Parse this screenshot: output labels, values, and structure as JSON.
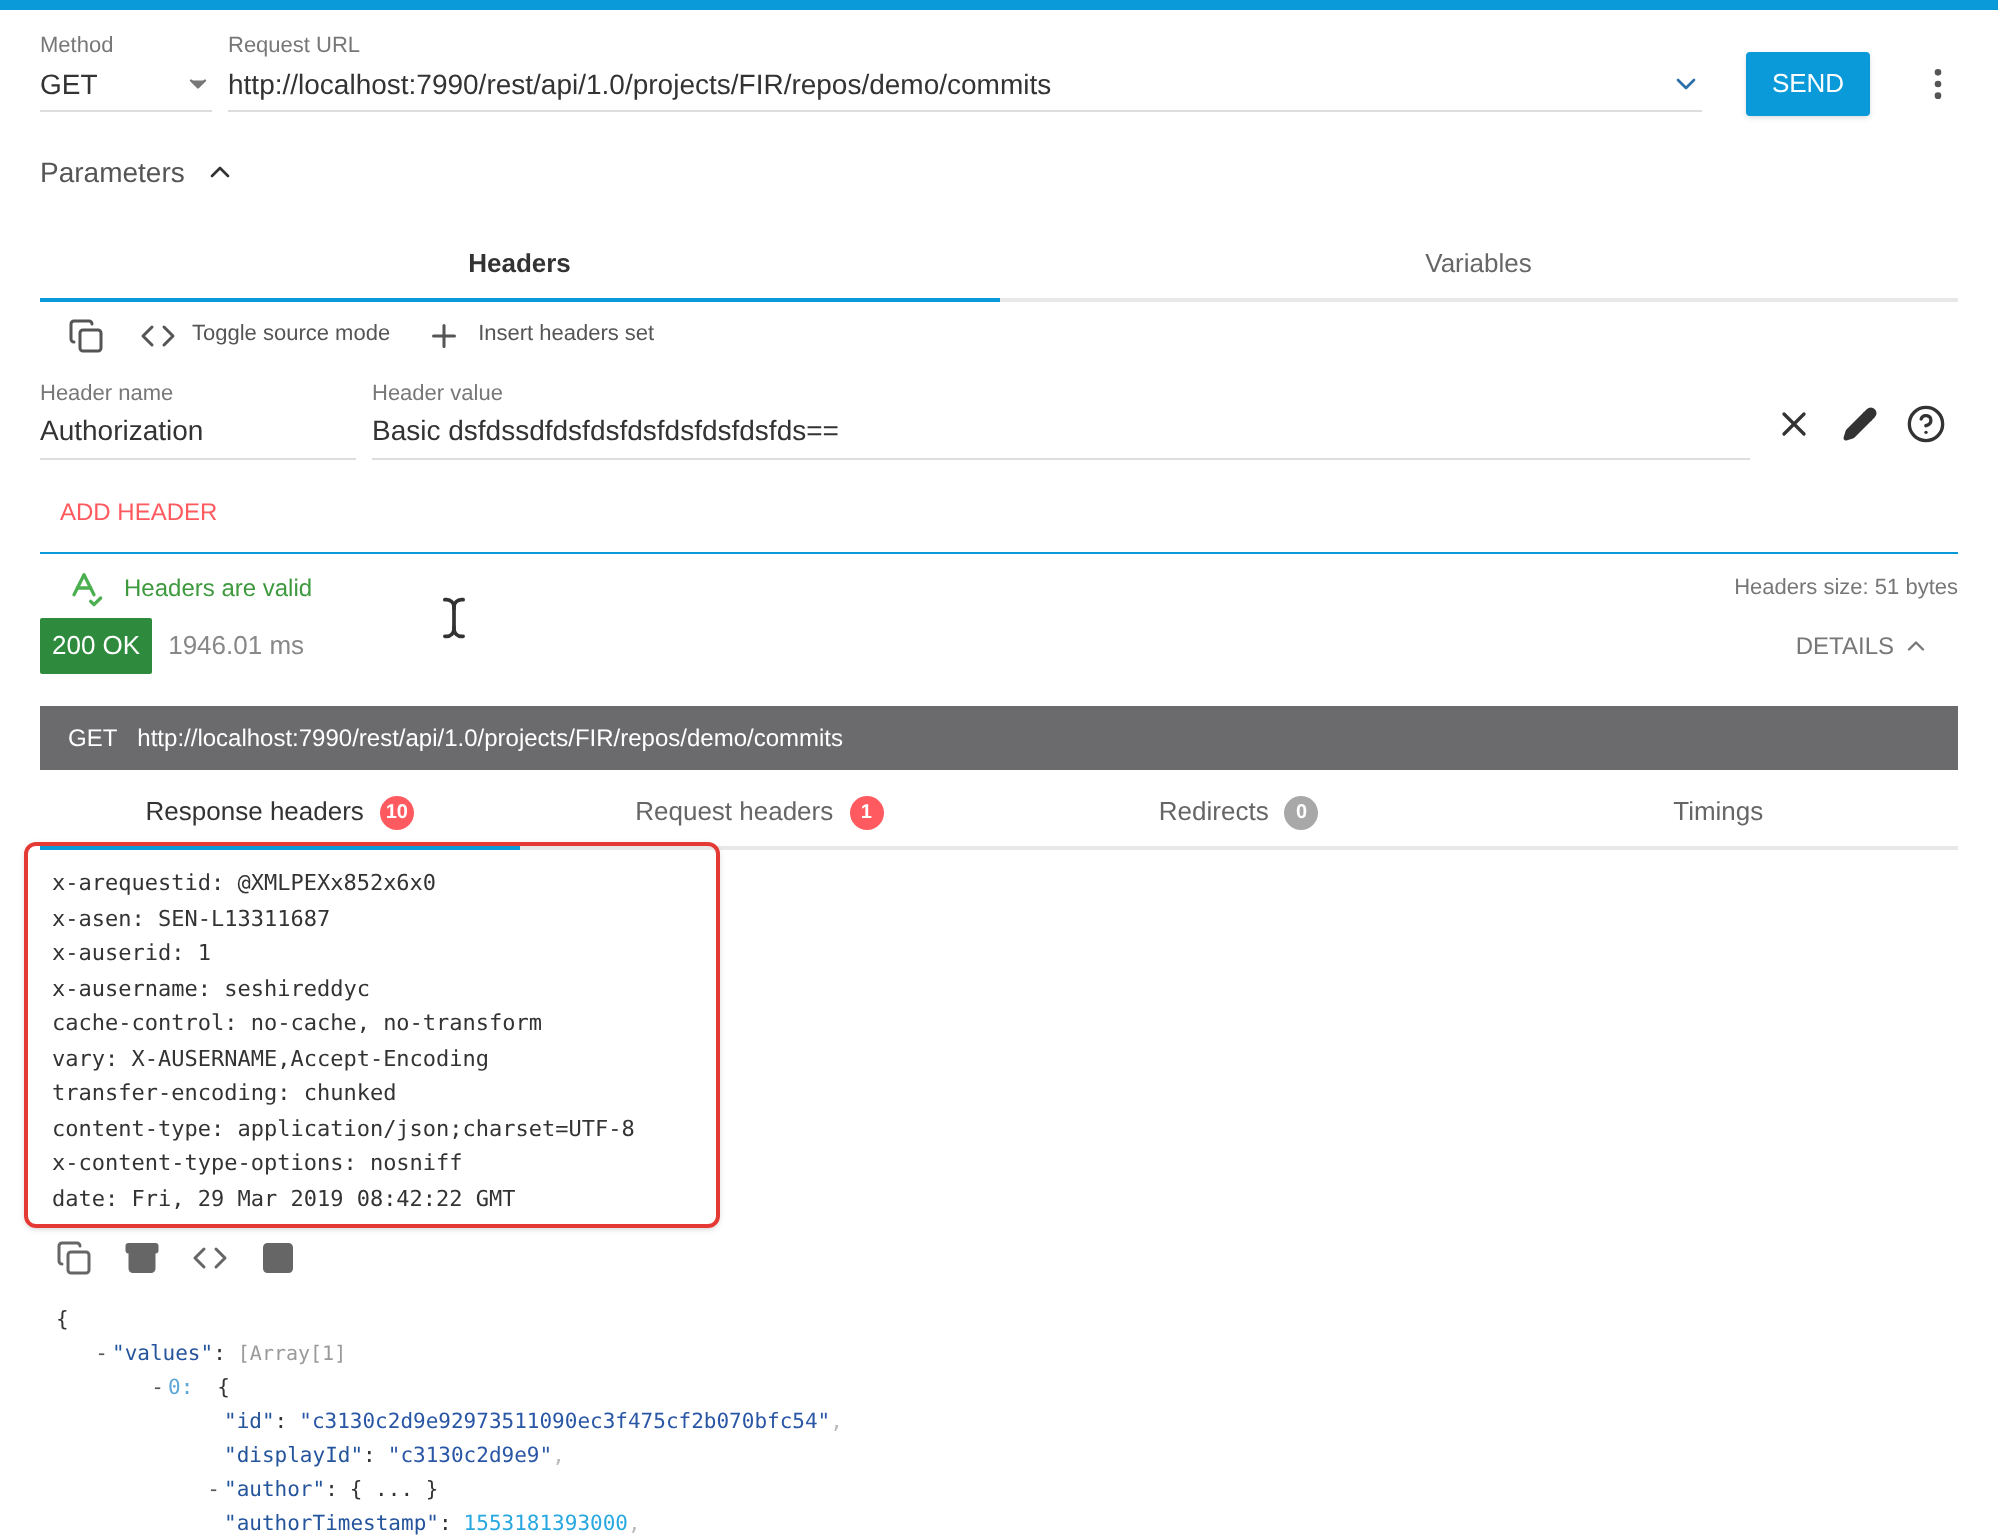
{
  "request": {
    "method_label": "Method",
    "method": "GET",
    "url_label": "Request URL",
    "url": "http://localhost:7990/rest/api/1.0/projects/FIR/repos/demo/commits",
    "send": "SEND"
  },
  "parameters": {
    "title": "Parameters",
    "expanded": true
  },
  "tabs": [
    {
      "label": "Headers",
      "selected": true
    },
    {
      "label": "Variables",
      "selected": false
    }
  ],
  "toolbar": {
    "toggle": "Toggle source mode",
    "insert": "Insert headers set"
  },
  "header_row": {
    "name_label": "Header name",
    "name": "Authorization",
    "value_label": "Header value",
    "value": "Basic dsfdssdfdsfdsfdsfdsfdsfdsfds=="
  },
  "add_header": "ADD HEADER",
  "validation": {
    "message": "Headers are valid",
    "size": "Headers size: 51 bytes"
  },
  "response": {
    "status": "200 OK",
    "time": "1946.01 ms",
    "details": "DETAILS",
    "details_expanded": true,
    "method": "GET",
    "url": "http://localhost:7990/rest/api/1.0/projects/FIR/repos/demo/commits"
  },
  "response_tabs": [
    {
      "label": "Response headers",
      "count": "10",
      "color": "#ff5a5f",
      "selected": true
    },
    {
      "label": "Request headers",
      "count": "1",
      "color": "#ff5a5f",
      "selected": false
    },
    {
      "label": "Redirects",
      "count": "0",
      "color": "#a8a8a8",
      "selected": false
    },
    {
      "label": "Timings",
      "selected": false
    }
  ],
  "response_headers": [
    "x-arequestid: @XMLPEXx852x6x0",
    "x-asen: SEN-L13311687",
    "x-auserid: 1",
    "x-ausername: seshireddyc",
    "cache-control: no-cache, no-transform",
    "vary: X-AUSERNAME,Accept-Encoding",
    "transfer-encoding: chunked",
    "content-type: application/json;charset=UTF-8",
    "x-content-type-options: nosniff",
    "date: Fri, 29 Mar 2019 08:42:22 GMT"
  ],
  "json_tree": [
    {
      "kind": "brace",
      "text": "{",
      "children": [
        {
          "kind": "prop",
          "toggle": "-",
          "key": "\"values\"",
          "sep": ":",
          "summary": "[Array[1]",
          "children": [
            {
              "kind": "index",
              "toggle": "-",
              "key": "0:",
              "text": "{",
              "children": [
                {
                  "kind": "prop",
                  "key": "\"id\"",
                  "sep": ":",
                  "value": {
                    "kind": "string",
                    "text": "\"c3130c2d9e92973511090ec3f475cf2b070bfc54\""
                  },
                  "comma": ","
                },
                {
                  "kind": "prop",
                  "key": "\"displayId\"",
                  "sep": ":",
                  "value": {
                    "kind": "string",
                    "text": "\"c3130c2d9e9\""
                  },
                  "comma": ","
                },
                {
                  "kind": "prop",
                  "toggle": "-",
                  "key": "\"author\"",
                  "sep": ":",
                  "value": {
                    "kind": "collapsed",
                    "text": "{ ... }"
                  }
                },
                {
                  "kind": "prop",
                  "key": "\"authorTimestamp\"",
                  "sep": ":",
                  "value": {
                    "kind": "number",
                    "text": "1553181393000"
                  },
                  "comma": ","
                }
              ]
            }
          ]
        }
      ]
    }
  ]
}
